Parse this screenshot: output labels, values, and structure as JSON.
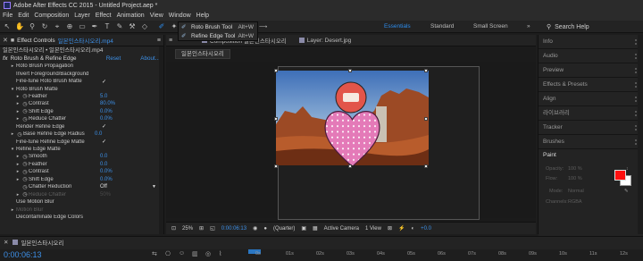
{
  "window": {
    "title": "Adobe After Effects CC 2015 - Untitled Project.aep *"
  },
  "menu": [
    "File",
    "Edit",
    "Composition",
    "Layer",
    "Effect",
    "Animation",
    "View",
    "Window",
    "Help"
  ],
  "workspaces": {
    "items": [
      "Essentials",
      "Standard",
      "Small Screen"
    ],
    "active": "Essentials",
    "menu": "»",
    "search": "Search Help"
  },
  "brush_menu": [
    {
      "label": "Roto Brush Tool",
      "shortcut": "Alt+W"
    },
    {
      "label": "Refine Edge Tool",
      "shortcut": "Alt+W"
    }
  ],
  "effect_controls": {
    "tab_label": "Effect Controls",
    "tab_comp": "일본인스타시오리.mp4",
    "breadcrumb": "일본인스타시오리 • 일본인스타시오리.mp4",
    "effect_name": "Roto Brush & Refine Edge",
    "reset": "Reset",
    "about": "About...",
    "properties": [
      {
        "indent": 1,
        "twirl": "▸",
        "name": "Roto Brush Propagation",
        "value": "",
        "kind": "text"
      },
      {
        "indent": 1,
        "twirl": "",
        "name": "Invert Foreground/Background",
        "value": "",
        "kind": "check"
      },
      {
        "indent": 1,
        "twirl": "",
        "name": "Fine-tune Roto Brush Matte",
        "value": "✓",
        "kind": "check"
      },
      {
        "indent": 1,
        "twirl": "▾",
        "name": "Roto Brush Matte",
        "value": "",
        "kind": "text"
      },
      {
        "indent": 2,
        "twirl": "▸",
        "sw": true,
        "name": "Feather",
        "value": "5.0",
        "kind": "num"
      },
      {
        "indent": 2,
        "twirl": "▸",
        "sw": true,
        "name": "Contrast",
        "value": "80.0%",
        "kind": "num"
      },
      {
        "indent": 2,
        "twirl": "▸",
        "sw": true,
        "name": "Shift Edge",
        "value": "0.0%",
        "kind": "num"
      },
      {
        "indent": 2,
        "twirl": "▸",
        "sw": true,
        "name": "Reduce Chatter",
        "value": "0.0%",
        "kind": "num"
      },
      {
        "indent": 1,
        "twirl": "",
        "name": "Render Refine Edge",
        "value": "✓",
        "kind": "check"
      },
      {
        "indent": 1,
        "twirl": "▸",
        "sw": true,
        "name": "Base Refine Edge Radius",
        "value": "0.0",
        "kind": "num"
      },
      {
        "indent": 1,
        "twirl": "",
        "name": "Fine-tune Refine Edge Matte",
        "value": "✓",
        "kind": "check"
      },
      {
        "indent": 1,
        "twirl": "▾",
        "name": "Refine Edge Matte",
        "value": "",
        "kind": "text"
      },
      {
        "indent": 2,
        "twirl": "▸",
        "sw": true,
        "name": "Smooth",
        "value": "0.0",
        "kind": "num"
      },
      {
        "indent": 2,
        "twirl": "▸",
        "sw": true,
        "name": "Feather",
        "value": "0.0",
        "kind": "num"
      },
      {
        "indent": 2,
        "twirl": "▸",
        "sw": true,
        "name": "Contrast",
        "value": "0.0%",
        "kind": "num"
      },
      {
        "indent": 2,
        "twirl": "▸",
        "sw": true,
        "name": "Shift Edge",
        "value": "0.0%",
        "kind": "num"
      },
      {
        "indent": 2,
        "twirl": "",
        "sw": true,
        "name": "Chatter Reduction",
        "value": "Off",
        "kind": "dropdown"
      },
      {
        "indent": 2,
        "twirl": "▸",
        "sw": true,
        "name": "Reduce Chatter",
        "value": "50%",
        "kind": "dim"
      },
      {
        "indent": 1,
        "twirl": "",
        "name": "Use Motion Blur",
        "value": "",
        "kind": "check"
      },
      {
        "indent": 1,
        "twirl": "▸",
        "name": "Motion Blur",
        "value": "",
        "kind": "dimtext"
      },
      {
        "indent": 1,
        "twirl": "",
        "name": "Decontaminate Edge Colors",
        "value": "",
        "kind": "check"
      }
    ]
  },
  "composition": {
    "tabs": [
      "Composition 일본인스타시오리",
      "Layer: Desert.jpg"
    ],
    "tab_icon_label": "Composition",
    "active_comp": "일본인스타시오리",
    "viewer_bar": {
      "zoom": "25%",
      "timecode": "0:00:06:13",
      "resolution": "(Quarter)",
      "camera": "Active Camera",
      "view": "1 View",
      "exposure": "+0.0"
    }
  },
  "right_panels": [
    "Info",
    "Audio",
    "Preview",
    "Effects & Presets",
    "Align",
    "라이브러리",
    "Tracker",
    "Brushes"
  ],
  "paint": {
    "title": "Paint",
    "opacity_label": "Opacity:",
    "opacity": "100 %",
    "flow_label": "Flow:",
    "flow": "100 %",
    "mode_label": "Mode:",
    "mode": "Normal",
    "channels_label": "Channels:",
    "channels": "RGBA",
    "fg_color": "#ff1010",
    "bg_color": "#ffffff"
  },
  "timeline": {
    "tab": "일본인스타시오리",
    "timecode": "0:00:06:13",
    "ruler": [
      "0s",
      "01s",
      "02s",
      "03s",
      "04s",
      "05s",
      "06s",
      "07s",
      "08s",
      "09s",
      "10s",
      "11s",
      "12s"
    ]
  }
}
